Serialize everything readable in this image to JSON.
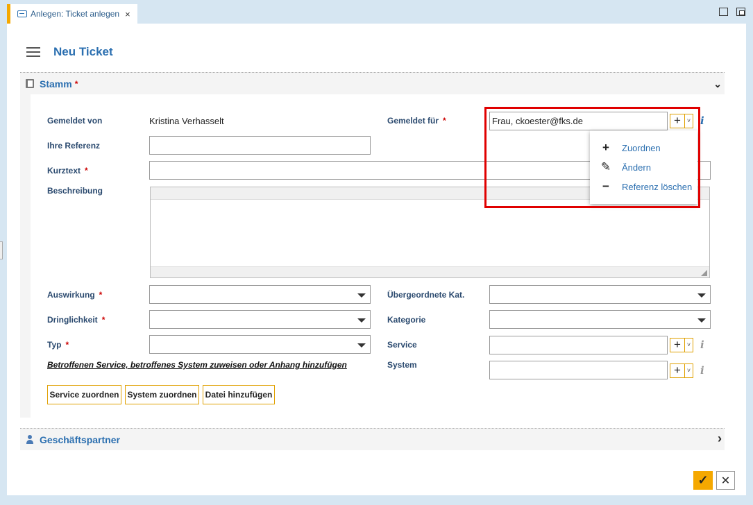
{
  "tab": {
    "title": "Anlegen: Ticket anlegen",
    "close": "×"
  },
  "page": {
    "title": "Neu Ticket"
  },
  "sections": {
    "stamm": "Stamm",
    "stamm_star": "*",
    "gp": "Geschäftspartner",
    "chev_down": "⌄",
    "chev_right": "›"
  },
  "fields": {
    "gemeldet_von": {
      "label": "Gemeldet von",
      "value": "Kristina Verhasselt"
    },
    "gemeldet_fuer": {
      "label": "Gemeldet für",
      "value": "Frau, ckoester@fks.de"
    },
    "ihre_referenz": {
      "label": "Ihre Referenz",
      "value": ""
    },
    "kurztext": {
      "label": "Kurztext",
      "value": ""
    },
    "beschreibung": {
      "label": "Beschreibung"
    },
    "auswirkung": {
      "label": "Auswirkung",
      "value": ""
    },
    "dringlichkeit": {
      "label": "Dringlichkeit",
      "value": ""
    },
    "typ": {
      "label": "Typ",
      "value": ""
    },
    "uebergeordnete_kat": {
      "label": "Übergeordnete Kat.",
      "value": ""
    },
    "kategorie": {
      "label": "Kategorie",
      "value": ""
    },
    "service": {
      "label": "Service",
      "value": ""
    },
    "system": {
      "label": "System",
      "value": ""
    }
  },
  "required_marker": "*",
  "plus": "+",
  "caret": "˅",
  "info": "i",
  "assign_link": "Betroffenen Service, betroffenes System zuweisen oder Anhang hinzufügen",
  "buttons": {
    "service": "Service zuordnen",
    "system": "System zuordnen",
    "datei": "Datei hinzufügen"
  },
  "dropdown": [
    {
      "icon": "+",
      "label": "Zuordnen"
    },
    {
      "icon": "✎",
      "label": "Ändern"
    },
    {
      "icon": "−",
      "label": "Referenz löschen"
    }
  ],
  "footer": {
    "ok": "✓",
    "cancel": "✕"
  },
  "colors": {
    "accent": "#f5a800",
    "link": "#2b6fb0",
    "highlight": "#e00000"
  }
}
